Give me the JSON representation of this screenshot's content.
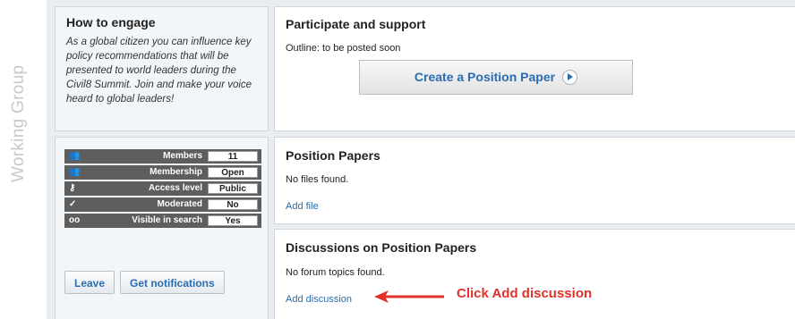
{
  "sidebar_label": "Working Group",
  "engage": {
    "title": "How to engage",
    "body": "As a global citizen you can influence key policy recommendations that will be presented to world leaders during the Civil8 Summit.  Join and make your voice heard to global leaders!"
  },
  "stats": [
    {
      "icon": "members-icon",
      "glyph": "👥",
      "label": "Members",
      "value": "11"
    },
    {
      "icon": "membership-icon",
      "glyph": "👥",
      "label": "Membership",
      "value": "Open"
    },
    {
      "icon": "key-icon",
      "glyph": "⚷",
      "label": "Access level",
      "value": "Public"
    },
    {
      "icon": "checkmark-icon",
      "glyph": "✓",
      "label": "Moderated",
      "value": "No"
    },
    {
      "icon": "eye-icon",
      "glyph": "oo",
      "label": "Visible in search",
      "value": "Yes"
    }
  ],
  "buttons": {
    "leave": "Leave",
    "notifications": "Get notifications"
  },
  "participate": {
    "title": "Participate and support",
    "outline": "Outline: to be posted soon",
    "create_button": "Create a Position Paper"
  },
  "position_papers": {
    "title": "Position Papers",
    "empty": "No files found.",
    "add_link": "Add file"
  },
  "discussions": {
    "title": "Discussions on Position Papers",
    "empty": "No forum topics found.",
    "add_link": "Add discussion"
  },
  "annotation": {
    "text": "Click Add discussion",
    "color": "#e0322a"
  }
}
